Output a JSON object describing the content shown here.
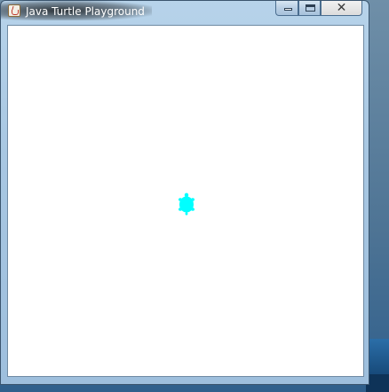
{
  "window": {
    "title": "Java Turtle Playground",
    "app_icon": "java-cup-icon",
    "controls": {
      "minimize_icon": "minimize-icon",
      "maximize_icon": "maximize-icon",
      "close_label": "✕"
    }
  },
  "canvas": {
    "background": "#ffffff",
    "turtle": {
      "icon": "turtle-icon",
      "color": "#00ffff"
    }
  }
}
